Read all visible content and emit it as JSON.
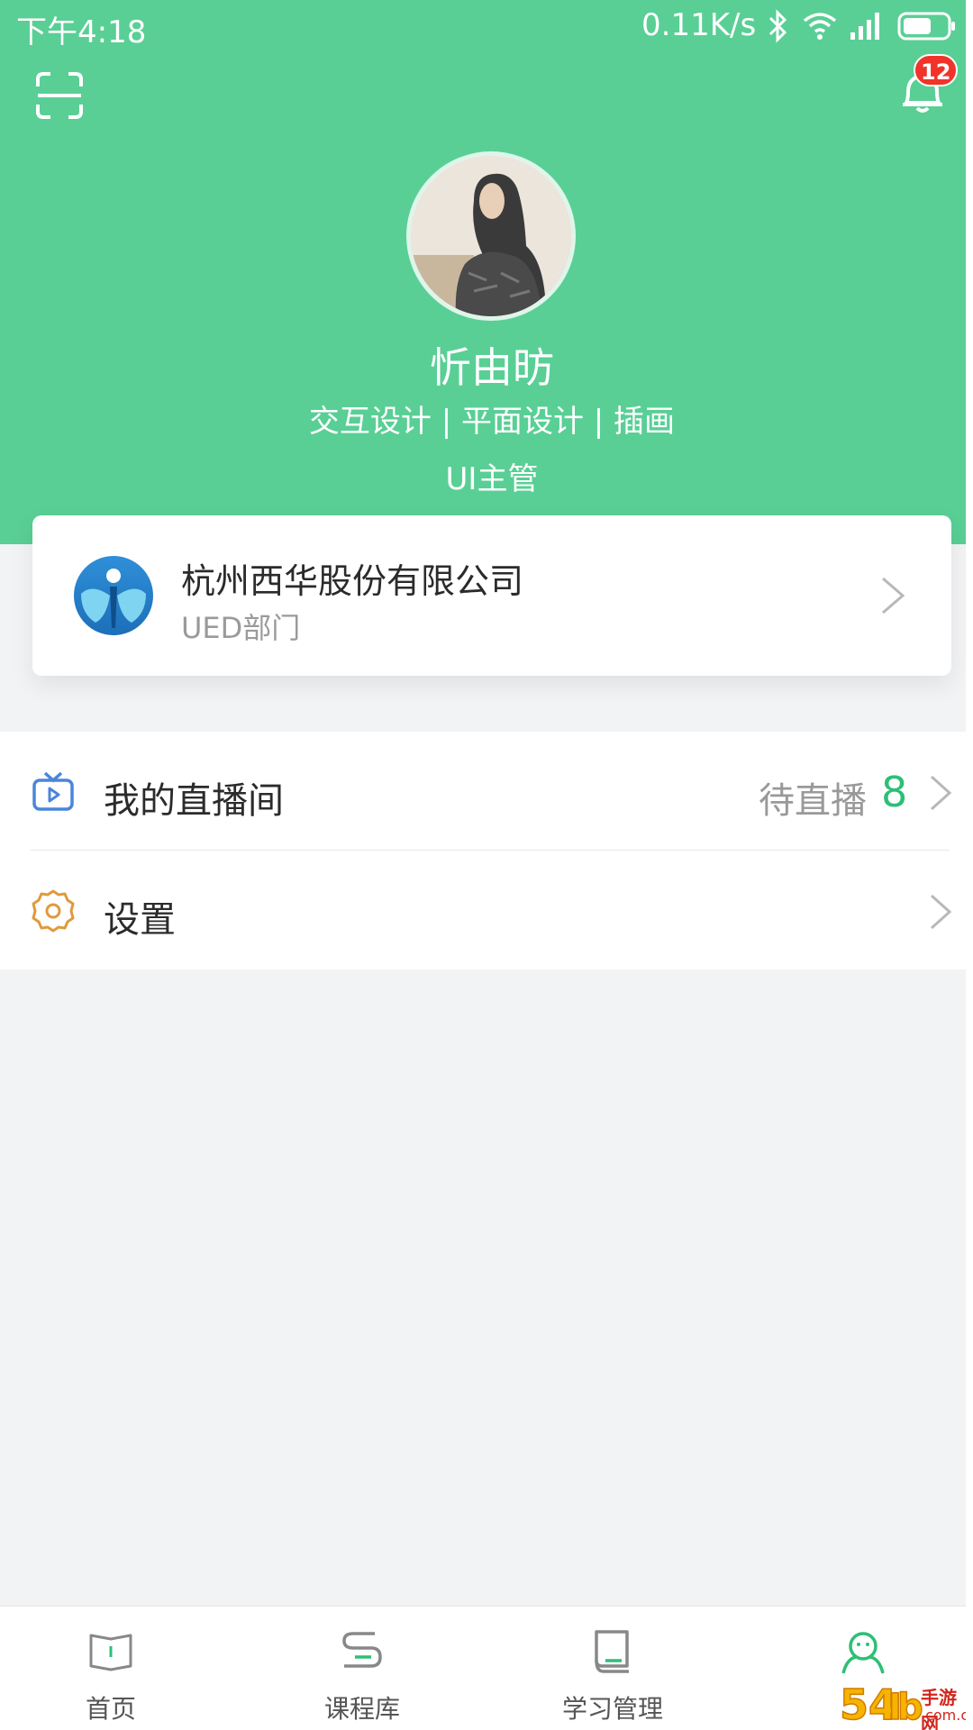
{
  "status_bar": {
    "time": "下午4:18",
    "network_speed": "0.11K/s",
    "icons": [
      "bluetooth-icon",
      "wifi-icon",
      "signal-icon",
      "battery-icon"
    ]
  },
  "header": {
    "scan_icon": "scan-icon",
    "bell_icon": "bell-icon",
    "notification_count": "12"
  },
  "profile": {
    "name": "忻由昉",
    "tags": "交互设计 | 平面设计 | 插画",
    "title": "UI主管"
  },
  "company": {
    "name": "杭州西华股份有限公司",
    "department": "UED部门"
  },
  "menu": {
    "items": [
      {
        "label": "我的直播间",
        "icon": "tv-icon",
        "right_text": "待直播",
        "count": "8"
      },
      {
        "label": "设置",
        "icon": "gear-icon"
      }
    ]
  },
  "tabbar": {
    "tabs": [
      {
        "label": "首页",
        "icon": "book-icon",
        "active": false
      },
      {
        "label": "课程库",
        "icon": "course-library-icon",
        "active": false
      },
      {
        "label": "学习管理",
        "icon": "study-management-icon",
        "active": false
      },
      {
        "label": "",
        "icon": "user-icon",
        "active": true
      }
    ]
  },
  "watermark": {
    "text": "手游网",
    "sub": ".com.cn"
  },
  "colors": {
    "primary_green": "#59cf95",
    "accent_green": "#2dbf76",
    "badge_red": "#f0342a",
    "live_icon_blue": "#4a86d9",
    "settings_icon_orange": "#e09a3c"
  }
}
